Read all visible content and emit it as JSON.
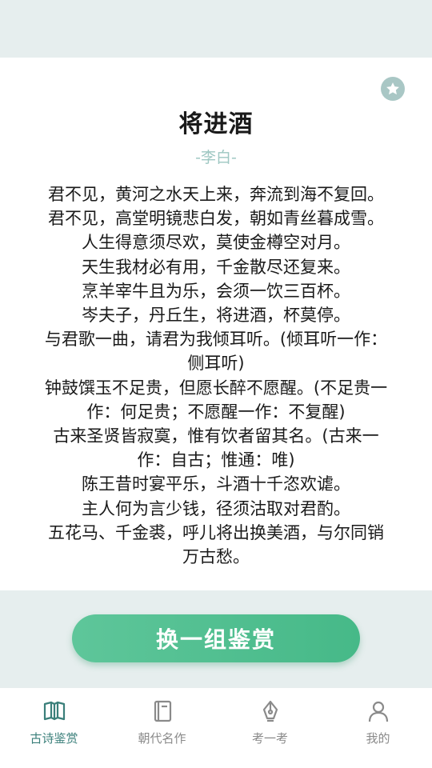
{
  "poem": {
    "title": "将进酒",
    "author": "-李白-",
    "lines": [
      "君不见，黄河之水天上来，奔流到海不复回。",
      "君不见，高堂明镜悲白发，朝如青丝暮成雪。",
      "人生得意须尽欢，莫使金樽空对月。",
      "天生我材必有用，千金散尽还复来。",
      "烹羊宰牛且为乐，会须一饮三百杯。",
      "岑夫子，丹丘生，将进酒，杯莫停。",
      "与君歌一曲，请君为我倾耳听。(倾耳听一作：",
      "侧耳听)",
      "钟鼓馔玉不足贵，但愿长醉不愿醒。(不足贵一",
      "作：何足贵；不愿醒一作：不复醒)",
      "古来圣贤皆寂寞，惟有饮者留其名。(古来一",
      "作：自古；惟通：唯)",
      "陈王昔时宴平乐，斗酒十千恣欢谑。",
      "主人何为言少钱，径须沽取对君酌。",
      "五花马、千金裘，呼儿将出换美酒，与尔同销",
      "万古愁。"
    ]
  },
  "actions": {
    "refresh_label": "换一组鉴赏",
    "favorite_icon": "star-icon"
  },
  "tabs": [
    {
      "label": "古诗鉴赏",
      "icon": "book-open-icon",
      "active": true
    },
    {
      "label": "朝代名作",
      "icon": "book-icon",
      "active": false
    },
    {
      "label": "考一考",
      "icon": "pen-nib-icon",
      "active": false
    },
    {
      "label": "我的",
      "icon": "user-icon",
      "active": false
    }
  ],
  "colors": {
    "accent": "#4fbe8f",
    "active_tab": "#3a7f7a",
    "author": "#9ec7c2",
    "background": "#e6eeee"
  }
}
